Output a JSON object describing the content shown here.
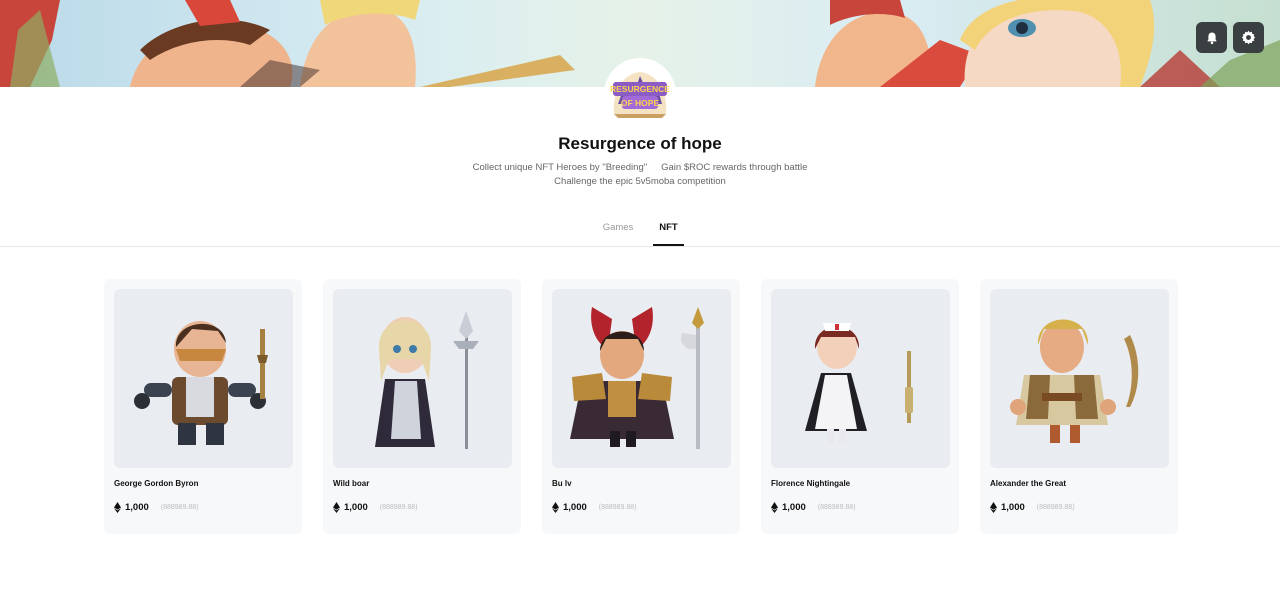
{
  "header": {
    "notification_icon": "bell-icon",
    "settings_icon": "gear-icon"
  },
  "collection": {
    "logo_text_line1": "RESURGENCE",
    "logo_text_line2": "OF HOPE",
    "title": "Resurgence of hope",
    "description": {
      "line1_part1": "Collect unique NFT Heroes by \"Breeding\"",
      "line1_part2": "Gain  $ROC rewards through battle",
      "line2": "Challenge the epic 5v5moba competition"
    }
  },
  "tabs": [
    {
      "label": "Games",
      "active": false
    },
    {
      "label": "NFT",
      "active": true
    }
  ],
  "currency_icon": "ethereum-icon",
  "nft_items": [
    {
      "name": "George Gordon Byron",
      "price": "1,000",
      "price_fiat": "(888989.88)"
    },
    {
      "name": "Wild boar",
      "price": "1,000",
      "price_fiat": "(888989.88)"
    },
    {
      "name": "Bu lv",
      "price": "1,000",
      "price_fiat": "(888989.88)"
    },
    {
      "name": "Florence Nightingale",
      "price": "1,000",
      "price_fiat": "(888989.88)"
    },
    {
      "name": "Alexander the Great",
      "price": "1,000",
      "price_fiat": "(888989.88)"
    }
  ],
  "colors": {
    "icon_button_bg": "#3a3f42",
    "card_bg": "#f7f8fa",
    "card_image_bg": "#e9ecf0",
    "muted_text": "#b8bcc2"
  }
}
